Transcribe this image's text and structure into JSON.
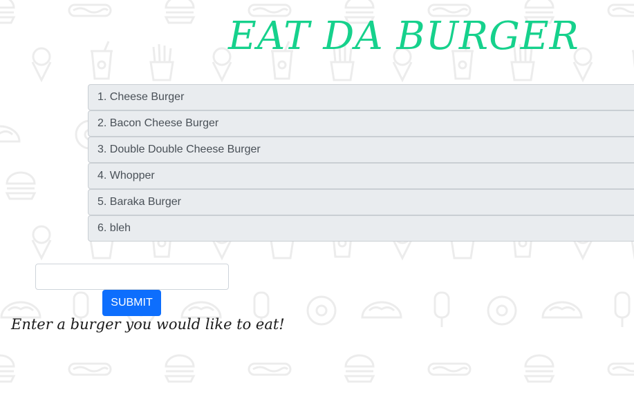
{
  "header": {
    "title": "EAT DA BURGER",
    "title_color": "#16d18c"
  },
  "burgers": [
    {
      "label": "1. Cheese Burger"
    },
    {
      "label": "2. Bacon Cheese Burger"
    },
    {
      "label": "3. Double Double Cheese Burger"
    },
    {
      "label": "4. Whopper"
    },
    {
      "label": "5. Baraka Burger"
    },
    {
      "label": "6. bleh"
    }
  ],
  "form": {
    "input_value": "",
    "input_placeholder": "",
    "submit_label": "SUBMIT",
    "submit_color": "#0d6efd",
    "prompt_text": "Enter a burger you would like to eat!"
  },
  "background": {
    "pattern_icons": [
      "hotdog-icon",
      "burger-icon",
      "soda-cup-icon",
      "fries-icon",
      "ice-cream-icon",
      "taco-icon",
      "donut-icon",
      "popsicle-icon"
    ],
    "pattern_color": "#efefef"
  }
}
